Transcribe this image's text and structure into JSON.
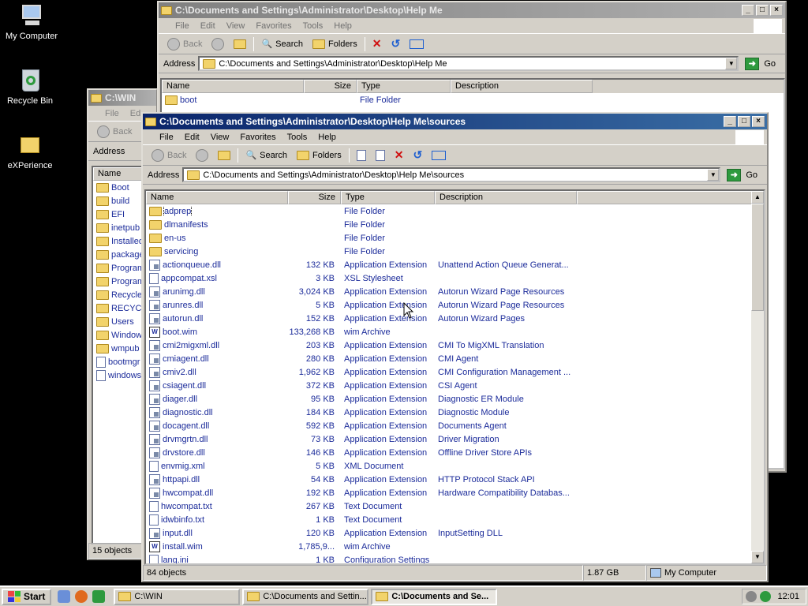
{
  "desktop": {
    "icons": [
      {
        "label": "My Computer"
      },
      {
        "label": "Recycle Bin"
      },
      {
        "label": "eXPerience"
      }
    ]
  },
  "menu": {
    "file": "File",
    "edit": "Edit",
    "view": "View",
    "favorites": "Favorites",
    "tools": "Tools",
    "help": "Help"
  },
  "toolbar": {
    "back": "Back",
    "search": "Search",
    "folders": "Folders"
  },
  "address_label": "Address",
  "go_label": "Go",
  "win_back": {
    "title": "C:\\WIN",
    "menu_partial": [
      "File",
      "Ed"
    ],
    "back": "Back",
    "address_label": "Address",
    "col_name": "Name",
    "items": [
      "Boot",
      "build",
      "EFI",
      "inetpub",
      "Installed",
      "package",
      "Program",
      "Program",
      "Recycle",
      "RECYCL",
      "Users",
      "Window",
      "wmpub",
      "bootmgr",
      "windows"
    ],
    "status": "15 objects"
  },
  "win_helpme": {
    "title": "C:\\Documents and Settings\\Administrator\\Desktop\\Help Me",
    "address": "C:\\Documents and Settings\\Administrator\\Desktop\\Help Me",
    "columns": {
      "name": "Name",
      "size": "Size",
      "type": "Type",
      "description": "Description"
    },
    "rows": [
      {
        "name": "boot",
        "type": "File Folder"
      }
    ]
  },
  "win_sources": {
    "title": "C:\\Documents and Settings\\Administrator\\Desktop\\Help Me\\sources",
    "address": "C:\\Documents and Settings\\Administrator\\Desktop\\Help Me\\sources",
    "columns": {
      "name": "Name",
      "size": "Size",
      "type": "Type",
      "description": "Description"
    },
    "rows": [
      {
        "name": "adprep",
        "size": "",
        "type": "File Folder",
        "desc": "",
        "icon": "folder"
      },
      {
        "name": "dlmanifests",
        "size": "",
        "type": "File Folder",
        "desc": "",
        "icon": "folder"
      },
      {
        "name": "en-us",
        "size": "",
        "type": "File Folder",
        "desc": "",
        "icon": "folder"
      },
      {
        "name": "servicing",
        "size": "",
        "type": "File Folder",
        "desc": "",
        "icon": "folder"
      },
      {
        "name": "actionqueue.dll",
        "size": "132 KB",
        "type": "Application Extension",
        "desc": "Unattend Action Queue Generat...",
        "icon": "dll"
      },
      {
        "name": "appcompat.xsl",
        "size": "3 KB",
        "type": "XSL Stylesheet",
        "desc": "",
        "icon": "doc"
      },
      {
        "name": "arunimg.dll",
        "size": "3,024 KB",
        "type": "Application Extension",
        "desc": "Autorun Wizard Page Resources",
        "icon": "dll"
      },
      {
        "name": "arunres.dll",
        "size": "5 KB",
        "type": "Application Extension",
        "desc": "Autorun Wizard Page Resources",
        "icon": "dll"
      },
      {
        "name": "autorun.dll",
        "size": "152 KB",
        "type": "Application Extension",
        "desc": "Autorun Wizard Pages",
        "icon": "dll"
      },
      {
        "name": "boot.wim",
        "size": "133,268 KB",
        "type": "wim Archive",
        "desc": "",
        "icon": "wim"
      },
      {
        "name": "cmi2migxml.dll",
        "size": "203 KB",
        "type": "Application Extension",
        "desc": "CMI To MigXML Translation",
        "icon": "dll"
      },
      {
        "name": "cmiagent.dll",
        "size": "280 KB",
        "type": "Application Extension",
        "desc": "CMI Agent",
        "icon": "dll"
      },
      {
        "name": "cmiv2.dll",
        "size": "1,962 KB",
        "type": "Application Extension",
        "desc": "CMI Configuration Management ...",
        "icon": "dll"
      },
      {
        "name": "csiagent.dll",
        "size": "372 KB",
        "type": "Application Extension",
        "desc": "CSI Agent",
        "icon": "dll"
      },
      {
        "name": "diager.dll",
        "size": "95 KB",
        "type": "Application Extension",
        "desc": "Diagnostic ER Module",
        "icon": "dll"
      },
      {
        "name": "diagnostic.dll",
        "size": "184 KB",
        "type": "Application Extension",
        "desc": "Diagnostic Module",
        "icon": "dll"
      },
      {
        "name": "docagent.dll",
        "size": "592 KB",
        "type": "Application Extension",
        "desc": "Documents Agent",
        "icon": "dll"
      },
      {
        "name": "drvmgrtn.dll",
        "size": "73 KB",
        "type": "Application Extension",
        "desc": "Driver Migration",
        "icon": "dll"
      },
      {
        "name": "drvstore.dll",
        "size": "146 KB",
        "type": "Application Extension",
        "desc": "Offline Driver Store APIs",
        "icon": "dll"
      },
      {
        "name": "envmig.xml",
        "size": "5 KB",
        "type": "XML Document",
        "desc": "",
        "icon": "doc"
      },
      {
        "name": "httpapi.dll",
        "size": "54 KB",
        "type": "Application Extension",
        "desc": "HTTP Protocol Stack API",
        "icon": "dll"
      },
      {
        "name": "hwcompat.dll",
        "size": "192 KB",
        "type": "Application Extension",
        "desc": "Hardware Compatibility Databas...",
        "icon": "dll"
      },
      {
        "name": "hwcompat.txt",
        "size": "267 KB",
        "type": "Text Document",
        "desc": "",
        "icon": "doc"
      },
      {
        "name": "idwbinfo.txt",
        "size": "1 KB",
        "type": "Text Document",
        "desc": "",
        "icon": "doc"
      },
      {
        "name": "input.dll",
        "size": "120 KB",
        "type": "Application Extension",
        "desc": "InputSetting DLL",
        "icon": "dll"
      },
      {
        "name": "install.wim",
        "size": "1,785,9...",
        "type": "wim Archive",
        "desc": "",
        "icon": "wim"
      },
      {
        "name": "lang.ini",
        "size": "1 KB",
        "type": "Configuration Settings",
        "desc": "",
        "icon": "doc"
      }
    ],
    "status_objects": "84 objects",
    "status_size": "1.87 GB",
    "status_location": "My Computer"
  },
  "taskbar": {
    "start": "Start",
    "tasks": [
      "C:\\WIN",
      "C:\\Documents and Settin...",
      "C:\\Documents and Se..."
    ],
    "clock": "12:01"
  }
}
